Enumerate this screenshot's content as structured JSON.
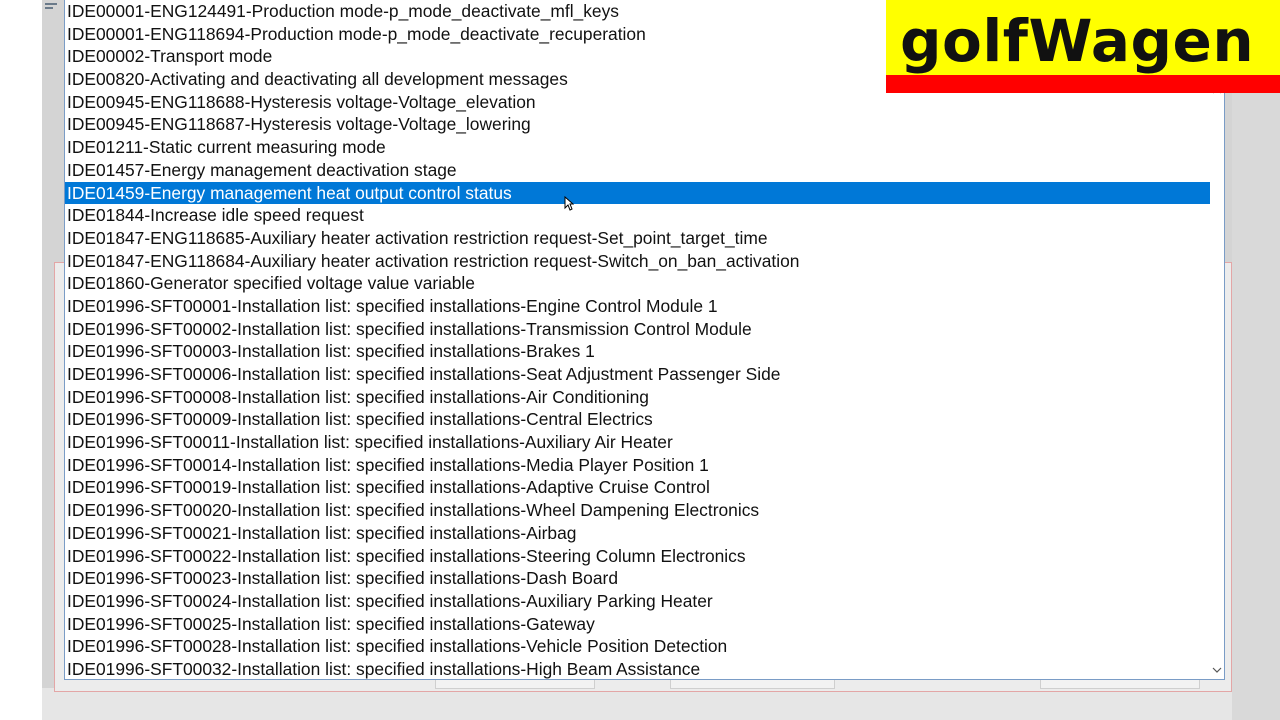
{
  "logo": {
    "text": "golfWagen",
    "background_color": "#ffff00",
    "stripe_color": "#ff0000"
  },
  "selection_color": "#0078d7",
  "list": {
    "selected_index": 8,
    "items": [
      "IDE00001-ENG124491-Production mode-p_mode_deactivate_mfl_keys",
      "IDE00001-ENG118694-Production mode-p_mode_deactivate_recuperation",
      "IDE00002-Transport mode",
      "IDE00820-Activating and deactivating all development messages",
      "IDE00945-ENG118688-Hysteresis voltage-Voltage_elevation",
      "IDE00945-ENG118687-Hysteresis voltage-Voltage_lowering",
      "IDE01211-Static current measuring mode",
      "IDE01457-Energy management deactivation stage",
      "IDE01459-Energy management heat output control status",
      "IDE01844-Increase idle speed request",
      "IDE01847-ENG118685-Auxiliary heater activation restriction request-Set_point_target_time",
      "IDE01847-ENG118684-Auxiliary heater activation restriction request-Switch_on_ban_activation",
      "IDE01860-Generator specified voltage value variable",
      "IDE01996-SFT00001-Installation list: specified installations-Engine Control Module 1",
      "IDE01996-SFT00002-Installation list: specified installations-Transmission Control Module",
      "IDE01996-SFT00003-Installation list: specified installations-Brakes 1",
      "IDE01996-SFT00006-Installation list: specified installations-Seat Adjustment Passenger Side",
      "IDE01996-SFT00008-Installation list: specified installations-Air Conditioning",
      "IDE01996-SFT00009-Installation list: specified installations-Central Electrics",
      "IDE01996-SFT00011-Installation list: specified installations-Auxiliary Air Heater",
      "IDE01996-SFT00014-Installation list: specified installations-Media Player Position 1",
      "IDE01996-SFT00019-Installation list: specified installations-Adaptive Cruise Control",
      "IDE01996-SFT00020-Installation list: specified installations-Wheel Dampening Electronics",
      "IDE01996-SFT00021-Installation list: specified installations-Airbag",
      "IDE01996-SFT00022-Installation list: specified installations-Steering Column Electronics",
      "IDE01996-SFT00023-Installation list: specified installations-Dash Board",
      "IDE01996-SFT00024-Installation list: specified installations-Auxiliary Parking Heater",
      "IDE01996-SFT00025-Installation list: specified installations-Gateway",
      "IDE01996-SFT00028-Installation list: specified installations-Vehicle Position Detection",
      "IDE01996-SFT00032-Installation list: specified installations-High Beam Assistance"
    ]
  }
}
